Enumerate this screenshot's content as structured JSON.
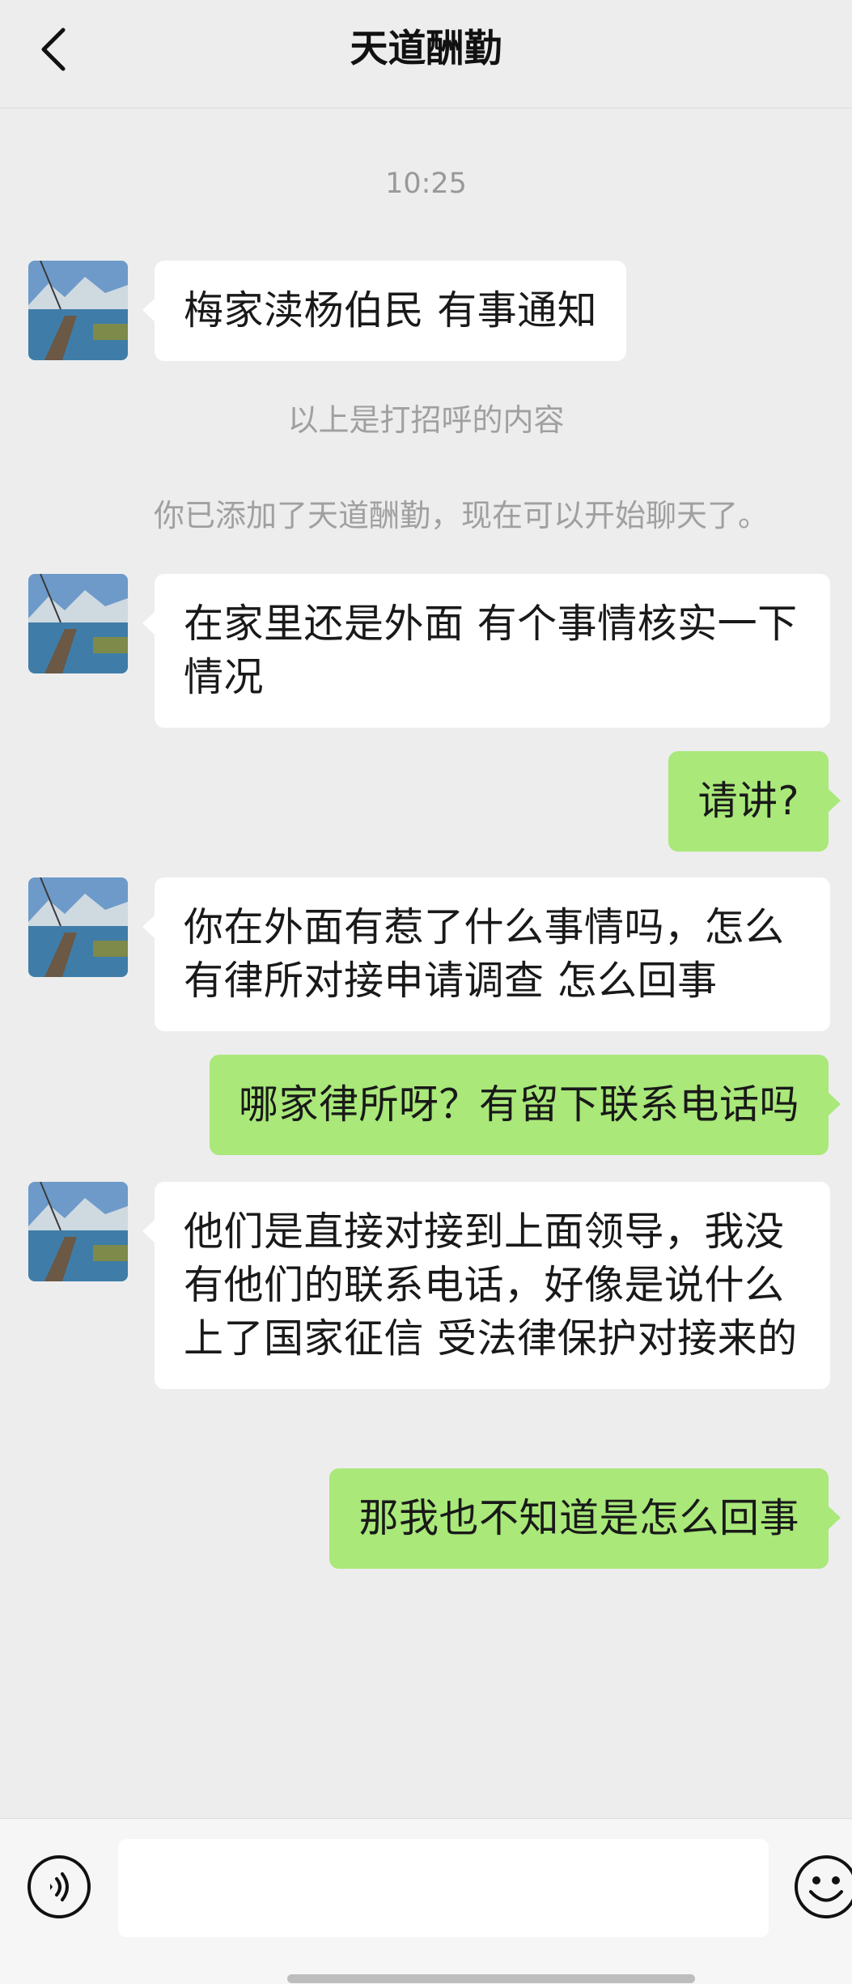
{
  "header": {
    "title": "天道酬勤",
    "back_icon": "chevron-left-icon"
  },
  "timestamp": "10:25",
  "system_messages": {
    "greeting_note": "以上是打招呼的内容",
    "added_note": "你已添加了天道酬勤，现在可以开始聊天了。"
  },
  "messages": [
    {
      "from": "contact",
      "text": "梅家渎杨伯民 有事通知"
    },
    {
      "from": "contact",
      "text": "在家里还是外面 有个事情核实一下情况"
    },
    {
      "from": "me",
      "text": "请讲?"
    },
    {
      "from": "contact",
      "text": "你在外面有惹了什么事情吗，怎么有律所对接申请调查 怎么回事"
    },
    {
      "from": "me",
      "text": "哪家律所呀？有留下联系电话吗"
    },
    {
      "from": "contact",
      "text": "他们是直接对接到上面领导，我没有他们的联系电话，好像是说什么上了国家征信 受法律保护对接来的"
    },
    {
      "from": "me",
      "text": "那我也不知道是怎么回事"
    }
  ],
  "input_bar": {
    "voice_icon": "voice-icon",
    "emoji_icon": "emoji-icon",
    "input_value": ""
  },
  "colors": {
    "background": "#ededed",
    "incoming_bubble": "#ffffff",
    "outgoing_bubble": "#a9e879"
  }
}
